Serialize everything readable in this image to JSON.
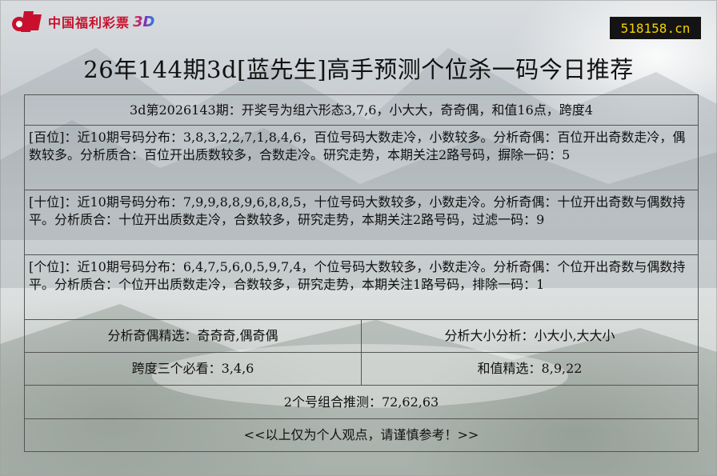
{
  "header": {
    "logo_text": "中国福利彩票",
    "logo_suffix": "3D",
    "site_badge": "518158.cn"
  },
  "page_title": "26年144期3d[蓝先生]高手预测个位杀一码今日推荐",
  "table": {
    "summary": "3d第2026143期：开奖号为组六形态3,7,6，小大大，奇奇偶，和值16点，跨度4",
    "hundreds": "[百位]：近10期号码分布：3,8,3,2,2,7,1,8,4,6，百位号码大数走冷，小数较多。分析奇偶：百位开出奇数走冷，偶数较多。分析质合：百位开出质数较多，合数走冷。研究走势，本期关注2路号码，摒除一码：5",
    "tens": "[十位]：近10期号码分布：7,9,9,8,8,9,6,8,8,5，十位号码大数较多，小数走冷。分析奇偶：十位开出奇数与偶数持平。分析质合：十位开出质数走冷，合数较多，研究走势，本期关注2路号码，过滤一码：9",
    "units": "[个位]：近10期号码分布：6,4,7,5,6,0,5,9,7,4，个位号码大数较多，小数走冷。分析奇偶：个位开出奇数与偶数持平。分析质合：个位开出质数走冷，合数较多，研究走势，本期关注1路号码，排除一码：1",
    "odd_even": "分析奇偶精选：奇奇奇,偶奇偶",
    "big_small": "分析大小分析：小大小,大大小",
    "span": "跨度三个必看：3,4,6",
    "sum": "和值精选：8,9,22",
    "combo": "2个号组合推测：72,62,63",
    "disclaimer": "<<以上仅为个人观点，请谨慎参考！>>"
  },
  "colors": {
    "logo_red": "#c8102e",
    "badge_bg": "#141414",
    "badge_text": "#f5d000"
  }
}
